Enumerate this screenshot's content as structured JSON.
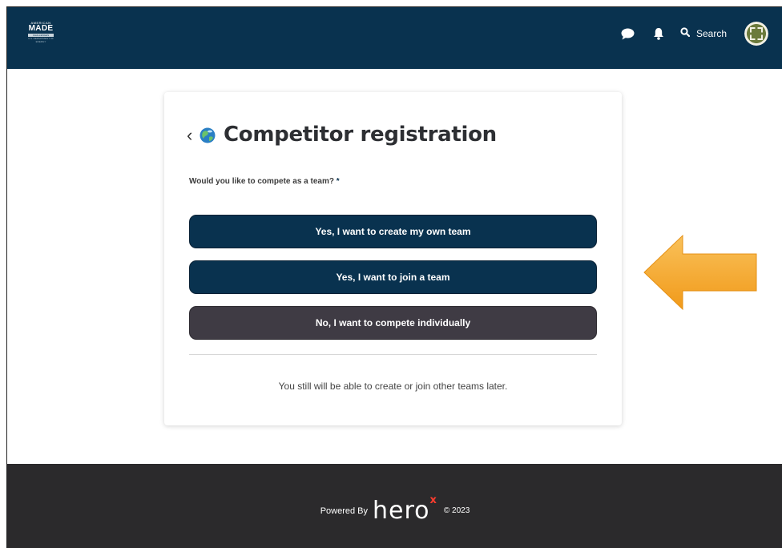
{
  "header": {
    "logo": {
      "line1": "AMERICAN",
      "line2": "MADE",
      "line3": "CHALLENGES",
      "line4": "U.S. DEPARTMENT OF ENERGY"
    },
    "icons": [
      "chat-icon",
      "bell-icon",
      "search-icon"
    ],
    "search_label": "Search"
  },
  "card": {
    "title": "Competitor registration",
    "question": "Would you like to compete as a team?",
    "required_marker": " *",
    "options": [
      "Yes, I want to create my own team",
      "Yes, I want to join a team",
      "No, I want to compete individually"
    ],
    "note": "You still will be able to create or join other teams later."
  },
  "footer": {
    "powered_by": "Powered By",
    "brand": "hero",
    "brand_mark": "x",
    "copyright": "© 2023"
  },
  "colors": {
    "header_bg": "#09324f",
    "primary_button": "#09324f",
    "secondary_button": "#3f3b44",
    "footer_bg": "#2b2a2c",
    "arrow": "#f6a623",
    "brand_x": "#ff3c2e"
  }
}
